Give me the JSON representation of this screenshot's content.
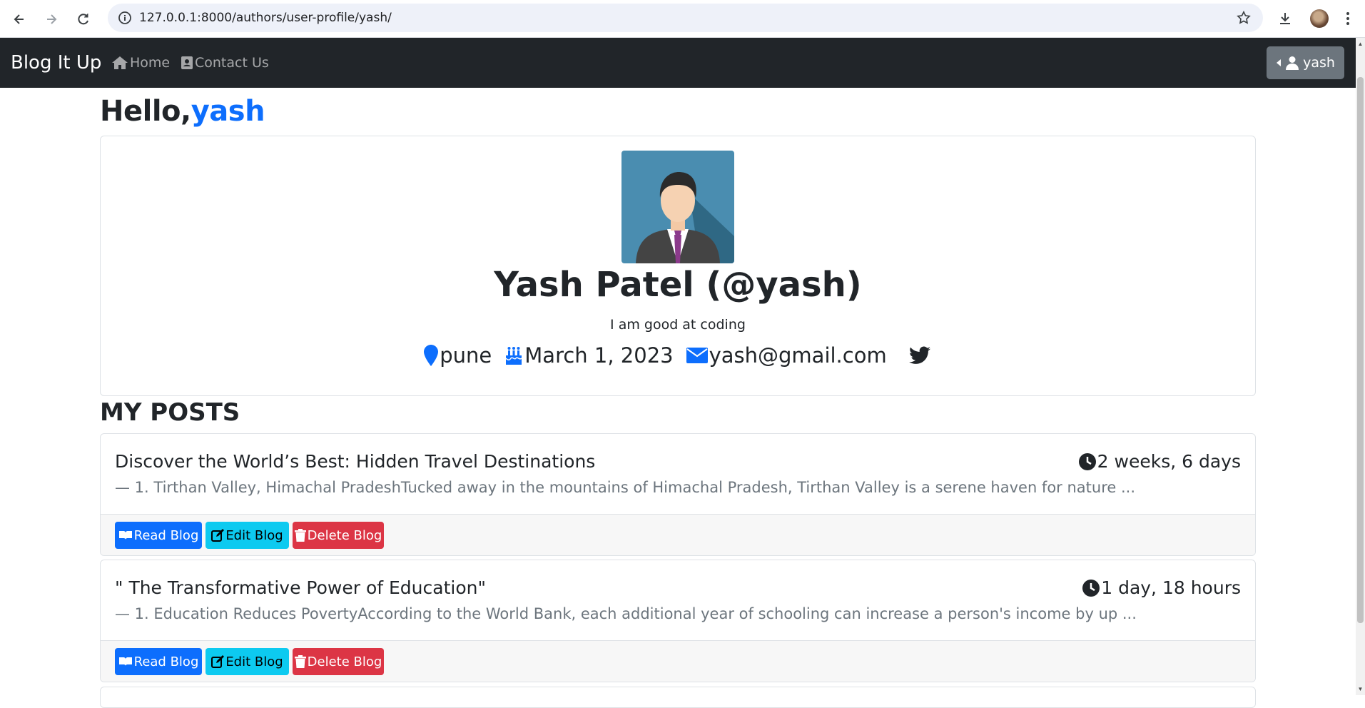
{
  "browser": {
    "url": "127.0.0.1:8000/authors/user-profile/yash/"
  },
  "navbar": {
    "brand": "Blog It Up",
    "links": [
      {
        "label": "Home",
        "icon": "home-icon"
      },
      {
        "label": "Contact Us",
        "icon": "contact-card-icon"
      }
    ],
    "user_menu_label": "yash"
  },
  "greeting": {
    "prefix": "Hello,",
    "username": "yash"
  },
  "profile": {
    "full_name": "Yash Patel (@yash)",
    "bio": "I am good at coding",
    "location": "pune",
    "birthday": "March 1, 2023",
    "email": "yash@gmail.com",
    "social_icon": "twitter-icon"
  },
  "posts_heading": "MY POSTS",
  "posts": [
    {
      "title": "Discover the World’s Best: Hidden Travel Destinations",
      "time_ago": "2 weeks, 6 days",
      "excerpt": "— 1. Tirthan Valley, Himachal PradeshTucked away in the mountains of Himachal Pradesh, Tirthan Valley is a serene haven for nature ...",
      "read_label": "Read Blog",
      "edit_label": "Edit Blog",
      "delete_label": "Delete Blog"
    },
    {
      "title": "\" The Transformative Power of Education\"",
      "time_ago": "1 day, 18 hours",
      "excerpt": "— 1. Education Reduces PovertyAccording to the World Bank, each additional year of schooling can increase a person's income by up ...",
      "read_label": "Read Blog",
      "edit_label": "Edit Blog",
      "delete_label": "Delete Blog"
    }
  ],
  "colors": {
    "navbar_bg": "#212529",
    "primary": "#0d6efd",
    "info": "#0dcaf0",
    "danger": "#dc3545",
    "secondary": "#6c757d"
  }
}
